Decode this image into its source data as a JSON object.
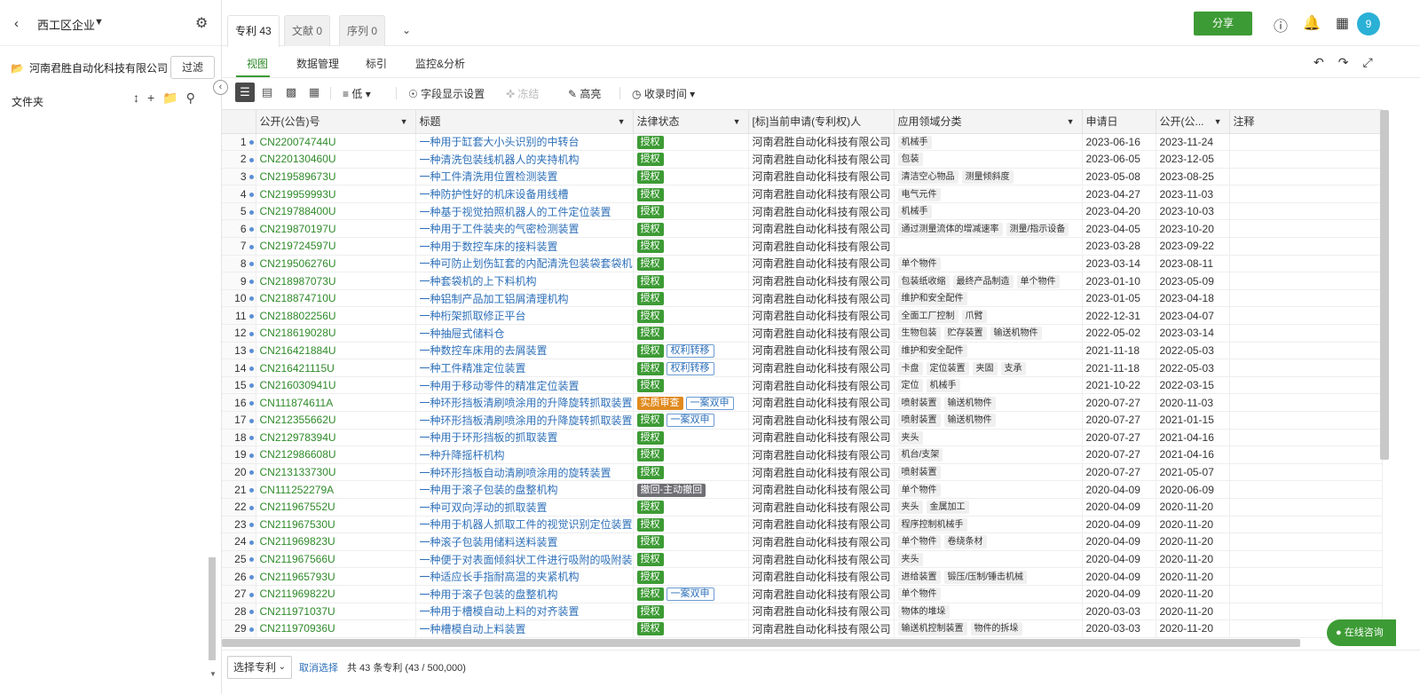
{
  "sidebar": {
    "title": "西工区企业",
    "company": "河南君胜自动化科技有限公司",
    "filter_label": "过滤",
    "folder_label": "文件夹"
  },
  "tabs": [
    {
      "label": "专利 43"
    },
    {
      "label": "文献 0"
    },
    {
      "label": "序列 0"
    }
  ],
  "share_label": "分享",
  "avatar_text": "9",
  "subtabs": [
    {
      "label": "视图"
    },
    {
      "label": "数据管理"
    },
    {
      "label": "标引"
    },
    {
      "label": "监控&分析"
    }
  ],
  "toolbar": {
    "density": "低",
    "fields": "字段显示设置",
    "freeze": "冻结",
    "highlight": "高亮",
    "time": "收录时间"
  },
  "columns": [
    "公开(公告)号",
    "标题",
    "法律状态",
    "[标]当前申请(专利权)人",
    "应用领域分类",
    "申请日",
    "公开(公...",
    "注释"
  ],
  "rows": [
    {
      "n": "1",
      "pn": "CN220074744U",
      "title": "一种用于缸套大小头识别的中转台",
      "status": [
        {
          "t": "授权",
          "c": "green"
        }
      ],
      "applicant": "河南君胜自动化科技有限公司",
      "tags": [
        "机械手"
      ],
      "app_date": "2023-06-16",
      "pub_date": "2023-11-24"
    },
    {
      "n": "2",
      "pn": "CN220130460U",
      "title": "一种清洗包装线机器人的夹持机构",
      "status": [
        {
          "t": "授权",
          "c": "green"
        }
      ],
      "applicant": "河南君胜自动化科技有限公司",
      "tags": [
        "包装"
      ],
      "app_date": "2023-06-05",
      "pub_date": "2023-12-05"
    },
    {
      "n": "3",
      "pn": "CN219589673U",
      "title": "一种工件清洗用位置检测装置",
      "status": [
        {
          "t": "授权",
          "c": "green"
        }
      ],
      "applicant": "河南君胜自动化科技有限公司",
      "tags": [
        "清洁空心物品",
        "测量倾斜度"
      ],
      "app_date": "2023-05-08",
      "pub_date": "2023-08-25"
    },
    {
      "n": "4",
      "pn": "CN219959993U",
      "title": "一种防护性好的机床设备用线槽",
      "status": [
        {
          "t": "授权",
          "c": "green"
        }
      ],
      "applicant": "河南君胜自动化科技有限公司",
      "tags": [
        "电气元件"
      ],
      "app_date": "2023-04-27",
      "pub_date": "2023-11-03"
    },
    {
      "n": "5",
      "pn": "CN219788400U",
      "title": "一种基于视觉拍照机器人的工件定位装置",
      "status": [
        {
          "t": "授权",
          "c": "green"
        }
      ],
      "applicant": "河南君胜自动化科技有限公司",
      "tags": [
        "机械手"
      ],
      "app_date": "2023-04-20",
      "pub_date": "2023-10-03"
    },
    {
      "n": "6",
      "pn": "CN219870197U",
      "title": "一种用于工件装夹的气密检测装置",
      "status": [
        {
          "t": "授权",
          "c": "green"
        }
      ],
      "applicant": "河南君胜自动化科技有限公司",
      "tags": [
        "通过测量流体的增减速率",
        "测量/指示设备"
      ],
      "app_date": "2023-04-05",
      "pub_date": "2023-10-20"
    },
    {
      "n": "7",
      "pn": "CN219724597U",
      "title": "一种用于数控车床的接料装置",
      "status": [
        {
          "t": "授权",
          "c": "green"
        }
      ],
      "applicant": "河南君胜自动化科技有限公司",
      "tags": [],
      "app_date": "2023-03-28",
      "pub_date": "2023-09-22"
    },
    {
      "n": "8",
      "pn": "CN219506276U",
      "title": "一种可防止划伤缸套的内配清洗包装袋套袋机",
      "status": [
        {
          "t": "授权",
          "c": "green"
        }
      ],
      "applicant": "河南君胜自动化科技有限公司",
      "tags": [
        "单个物件"
      ],
      "app_date": "2023-03-14",
      "pub_date": "2023-08-11"
    },
    {
      "n": "9",
      "pn": "CN218987073U",
      "title": "一种套袋机的上下料机构",
      "status": [
        {
          "t": "授权",
          "c": "green"
        }
      ],
      "applicant": "河南君胜自动化科技有限公司",
      "tags": [
        "包装纸收缩",
        "最终产品制造",
        "单个物件"
      ],
      "app_date": "2023-01-10",
      "pub_date": "2023-05-09"
    },
    {
      "n": "10",
      "pn": "CN218874710U",
      "title": "一种铝制产品加工铝屑清理机构",
      "status": [
        {
          "t": "授权",
          "c": "green"
        }
      ],
      "applicant": "河南君胜自动化科技有限公司",
      "tags": [
        "维护和安全配件"
      ],
      "app_date": "2023-01-05",
      "pub_date": "2023-04-18"
    },
    {
      "n": "11",
      "pn": "CN218802256U",
      "title": "一种桁架抓取修正平台",
      "status": [
        {
          "t": "授权",
          "c": "green"
        }
      ],
      "applicant": "河南君胜自动化科技有限公司",
      "tags": [
        "全面工厂控制",
        "爪臂"
      ],
      "app_date": "2022-12-31",
      "pub_date": "2023-04-07"
    },
    {
      "n": "12",
      "pn": "CN218619028U",
      "title": "一种抽屉式储料仓",
      "status": [
        {
          "t": "授权",
          "c": "green"
        }
      ],
      "applicant": "河南君胜自动化科技有限公司",
      "tags": [
        "生物包装",
        "贮存装置",
        "输送机物件"
      ],
      "app_date": "2022-05-02",
      "pub_date": "2023-03-14"
    },
    {
      "n": "13",
      "pn": "CN216421884U",
      "title": "一种数控车床用的去屑装置",
      "status": [
        {
          "t": "授权",
          "c": "green"
        },
        {
          "t": "权利转移",
          "c": "outline"
        }
      ],
      "applicant": "河南君胜自动化科技有限公司",
      "tags": [
        "维护和安全配件"
      ],
      "app_date": "2021-11-18",
      "pub_date": "2022-05-03"
    },
    {
      "n": "14",
      "pn": "CN216421115U",
      "title": "一种工件精准定位装置",
      "status": [
        {
          "t": "授权",
          "c": "green"
        },
        {
          "t": "权利转移",
          "c": "outline"
        }
      ],
      "applicant": "河南君胜自动化科技有限公司",
      "tags": [
        "卡盘",
        "定位装置",
        "夹固",
        "支承"
      ],
      "app_date": "2021-11-18",
      "pub_date": "2022-05-03"
    },
    {
      "n": "15",
      "pn": "CN216030941U",
      "title": "一种用于移动零件的精准定位装置",
      "status": [
        {
          "t": "授权",
          "c": "green"
        }
      ],
      "applicant": "河南君胜自动化科技有限公司",
      "tags": [
        "定位",
        "机械手"
      ],
      "app_date": "2021-10-22",
      "pub_date": "2022-03-15"
    },
    {
      "n": "16",
      "pn": "CN111874611A",
      "title": "一种环形挡板清刷喷涂用的升降旋转抓取装置",
      "status": [
        {
          "t": "实质审查",
          "c": "orange"
        },
        {
          "t": "一案双申",
          "c": "outline"
        }
      ],
      "applicant": "河南君胜自动化科技有限公司",
      "tags": [
        "喷射装置",
        "输送机物件"
      ],
      "app_date": "2020-07-27",
      "pub_date": "2020-11-03"
    },
    {
      "n": "17",
      "pn": "CN212355662U",
      "title": "一种环形挡板清刷喷涂用的升降旋转抓取装置",
      "status": [
        {
          "t": "授权",
          "c": "green"
        },
        {
          "t": "一案双申",
          "c": "outline"
        }
      ],
      "applicant": "河南君胜自动化科技有限公司",
      "tags": [
        "喷射装置",
        "输送机物件"
      ],
      "app_date": "2020-07-27",
      "pub_date": "2021-01-15"
    },
    {
      "n": "18",
      "pn": "CN212978394U",
      "title": "一种用于环形挡板的抓取装置",
      "status": [
        {
          "t": "授权",
          "c": "green"
        }
      ],
      "applicant": "河南君胜自动化科技有限公司",
      "tags": [
        "夹头"
      ],
      "app_date": "2020-07-27",
      "pub_date": "2021-04-16"
    },
    {
      "n": "19",
      "pn": "CN212986608U",
      "title": "一种升降摇杆机构",
      "status": [
        {
          "t": "授权",
          "c": "green"
        }
      ],
      "applicant": "河南君胜自动化科技有限公司",
      "tags": [
        "机台/支架"
      ],
      "app_date": "2020-07-27",
      "pub_date": "2021-04-16"
    },
    {
      "n": "20",
      "pn": "CN213133730U",
      "title": "一种环形挡板自动清刷喷涂用的旋转装置",
      "status": [
        {
          "t": "授权",
          "c": "green"
        }
      ],
      "applicant": "河南君胜自动化科技有限公司",
      "tags": [
        "喷射装置"
      ],
      "app_date": "2020-07-27",
      "pub_date": "2021-05-07"
    },
    {
      "n": "21",
      "pn": "CN111252279A",
      "title": "一种用于滚子包装的盘整机构",
      "status": [
        {
          "t": "撤回-主动撤回",
          "c": "gray"
        }
      ],
      "applicant": "河南君胜自动化科技有限公司",
      "tags": [
        "单个物件"
      ],
      "app_date": "2020-04-09",
      "pub_date": "2020-06-09"
    },
    {
      "n": "22",
      "pn": "CN211967552U",
      "title": "一种可双向浮动的抓取装置",
      "status": [
        {
          "t": "授权",
          "c": "green"
        }
      ],
      "applicant": "河南君胜自动化科技有限公司",
      "tags": [
        "夹头",
        "金属加工"
      ],
      "app_date": "2020-04-09",
      "pub_date": "2020-11-20"
    },
    {
      "n": "23",
      "pn": "CN211967530U",
      "title": "一种用于机器人抓取工件的视觉识别定位装置",
      "status": [
        {
          "t": "授权",
          "c": "green"
        }
      ],
      "applicant": "河南君胜自动化科技有限公司",
      "tags": [
        "程序控制机械手"
      ],
      "app_date": "2020-04-09",
      "pub_date": "2020-11-20"
    },
    {
      "n": "24",
      "pn": "CN211969823U",
      "title": "一种滚子包装用储料送料装置",
      "status": [
        {
          "t": "授权",
          "c": "green"
        }
      ],
      "applicant": "河南君胜自动化科技有限公司",
      "tags": [
        "单个物件",
        "卷绕条材"
      ],
      "app_date": "2020-04-09",
      "pub_date": "2020-11-20"
    },
    {
      "n": "25",
      "pn": "CN211967566U",
      "title": "一种便于对表面倾斜状工件进行吸附的吸附装",
      "status": [
        {
          "t": "授权",
          "c": "green"
        }
      ],
      "applicant": "河南君胜自动化科技有限公司",
      "tags": [
        "夹头"
      ],
      "app_date": "2020-04-09",
      "pub_date": "2020-11-20"
    },
    {
      "n": "26",
      "pn": "CN211965793U",
      "title": "一种适应长手指耐高温的夹紧机构",
      "status": [
        {
          "t": "授权",
          "c": "green"
        }
      ],
      "applicant": "河南君胜自动化科技有限公司",
      "tags": [
        "进给装置",
        "锻压/压制/锤击机械"
      ],
      "app_date": "2020-04-09",
      "pub_date": "2020-11-20"
    },
    {
      "n": "27",
      "pn": "CN211969822U",
      "title": "一种用于滚子包装的盘整机构",
      "status": [
        {
          "t": "授权",
          "c": "green"
        },
        {
          "t": "一案双申",
          "c": "outline"
        }
      ],
      "applicant": "河南君胜自动化科技有限公司",
      "tags": [
        "单个物件"
      ],
      "app_date": "2020-04-09",
      "pub_date": "2020-11-20"
    },
    {
      "n": "28",
      "pn": "CN211971037U",
      "title": "一种用于槽模自动上料的对齐装置",
      "status": [
        {
          "t": "授权",
          "c": "green"
        }
      ],
      "applicant": "河南君胜自动化科技有限公司",
      "tags": [
        "物体的堆垛"
      ],
      "app_date": "2020-03-03",
      "pub_date": "2020-11-20"
    },
    {
      "n": "29",
      "pn": "CN211970936U",
      "title": "一种槽模自动上料装置",
      "status": [
        {
          "t": "授权",
          "c": "green"
        }
      ],
      "applicant": "河南君胜自动化科技有限公司",
      "tags": [
        "输送机控制装置",
        "物件的拆垛"
      ],
      "app_date": "2020-03-03",
      "pub_date": "2020-11-20"
    }
  ],
  "footer": {
    "select_label": "选择专利",
    "cancel_label": "取消选择",
    "count_text": "共 43 条专利 (43 / 500,000)"
  },
  "consult_label": "在线咨询"
}
